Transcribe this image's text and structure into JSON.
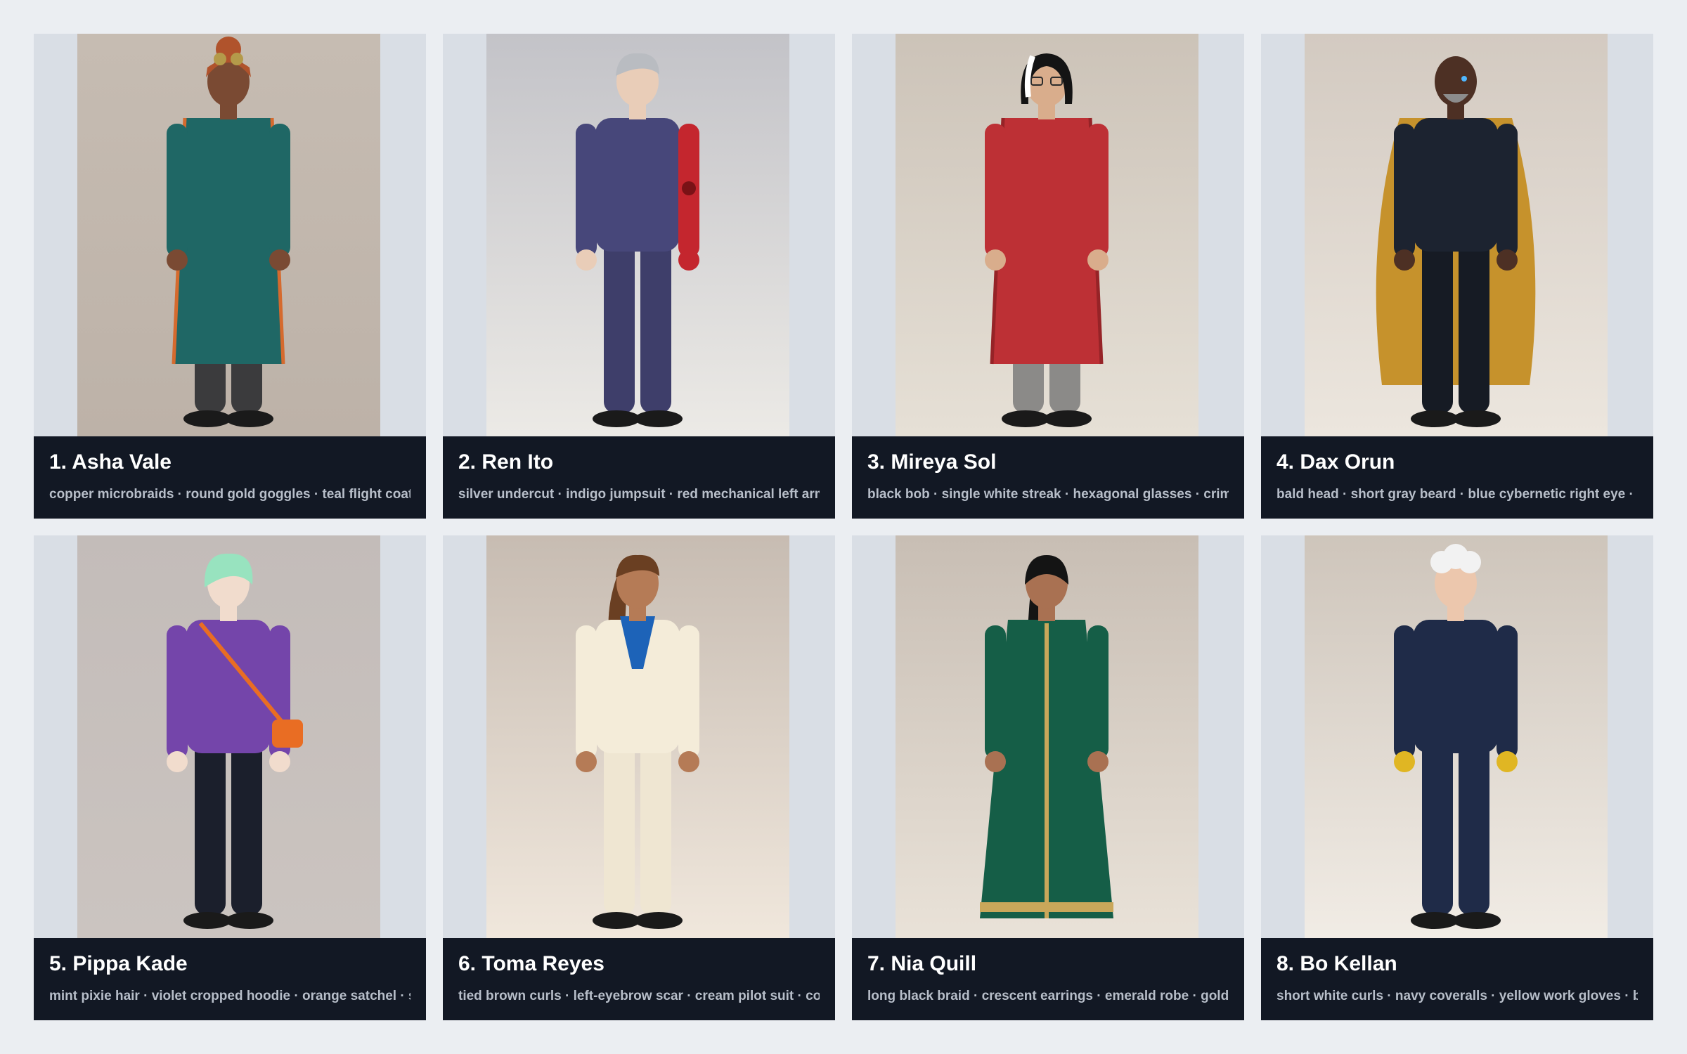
{
  "cards": [
    {
      "name": "1. Asha Vale",
      "traits": "copper microbraids · round gold goggles · teal flight coat ·",
      "bg_top": "#c6bcb2",
      "bg_bottom": "#bdb2a8",
      "skin": "#7a4a33",
      "hair": "#b0532c",
      "hair_style": "topknot",
      "outfit": "#1f6765",
      "outfit_trim": "#d56a2e",
      "pants": "#3b3b3d",
      "extra": "goggles",
      "extra_color": "#b49a4a",
      "icon": "character-portrait-icon"
    },
    {
      "name": "2. Ren Ito",
      "traits": "silver undercut · indigo jumpsuit · red mechanical left arm ·",
      "bg_top": "#c3c3c8",
      "bg_bottom": "#eceae6",
      "skin": "#e9cdb8",
      "hair": "#b9bcc1",
      "hair_style": "short",
      "outfit": "#47477a",
      "outfit_trim": "#35355f",
      "pants": "#3e3e6a",
      "extra": "mech-arm",
      "extra_color": "#c4262e",
      "icon": "character-portrait-icon"
    },
    {
      "name": "3. Mireya Sol",
      "traits": "black bob · single white streak · hexagonal glasses · crimson",
      "bg_top": "#ccc3b8",
      "bg_bottom": "#e6e0d6",
      "skin": "#d9ad8c",
      "hair": "#141414",
      "hair_style": "bob",
      "outfit": "#bd3035",
      "outfit_trim": "#962327",
      "pants": "#8b8a88",
      "extra": "glasses",
      "extra_color": "#2b2b2b",
      "icon": "character-portrait-icon"
    },
    {
      "name": "4. Dax Orun",
      "traits": "bald head · short gray beard · blue cybernetic right eye · mu",
      "bg_top": "#d3cac1",
      "bg_bottom": "#ece6de",
      "skin": "#4d3024",
      "hair": "#5a4036",
      "hair_style": "bald",
      "outfit": "#1c2330",
      "outfit_trim": "#2a3242",
      "pants": "#161b24",
      "extra": "cape",
      "extra_color": "#c6922c",
      "icon": "character-portrait-icon"
    },
    {
      "name": "5. Pippa Kade",
      "traits": "mint pixie hair · violet cropped hoodie · orange satchel · sm",
      "bg_top": "#c3bcb9",
      "bg_bottom": "#cbc4c0",
      "skin": "#f1dccd",
      "hair": "#98e3bf",
      "hair_style": "pixie",
      "outfit": "#7445aa",
      "outfit_trim": "#5e3590",
      "pants": "#1b1f2c",
      "extra": "satchel",
      "extra_color": "#e96d23",
      "icon": "character-portrait-icon"
    },
    {
      "name": "6. Toma Reyes",
      "traits": "tied brown curls · left-eyebrow scar · cream pilot suit · cob.",
      "bg_top": "#c7bcb2",
      "bg_bottom": "#f0e7dc",
      "skin": "#b57b56",
      "hair": "#6a3f22",
      "hair_style": "long",
      "outfit": "#f4ecd9",
      "outfit_trim": "#d9ceb7",
      "pants": "#efe6d2",
      "extra": "scarf",
      "extra_color": "#1d63b8",
      "icon": "character-portrait-icon"
    },
    {
      "name": "7. Nia Quill",
      "traits": "long black braid · crescent earrings · emerald robe · gold ge",
      "bg_top": "#c8beb4",
      "bg_bottom": "#e9e2d8",
      "skin": "#a97152",
      "hair": "#141414",
      "hair_style": "braid",
      "outfit": "#155e47",
      "outfit_trim": "#c9a75a",
      "pants": "#155e47",
      "extra": "robe",
      "extra_color": "#c9a75a",
      "icon": "character-portrait-icon"
    },
    {
      "name": "8. Bo Kellan",
      "traits": "short white curls · navy coveralls · yellow work gloves · bro",
      "bg_top": "#cec5bb",
      "bg_bottom": "#f1ece5",
      "skin": "#ecc7ad",
      "hair": "#f2f2f2",
      "hair_style": "curls",
      "outfit": "#1f2b48",
      "outfit_trim": "#16203a",
      "pants": "#1f2b48",
      "extra": "gloves",
      "extra_color": "#e0b623",
      "icon": "character-portrait-icon"
    }
  ]
}
